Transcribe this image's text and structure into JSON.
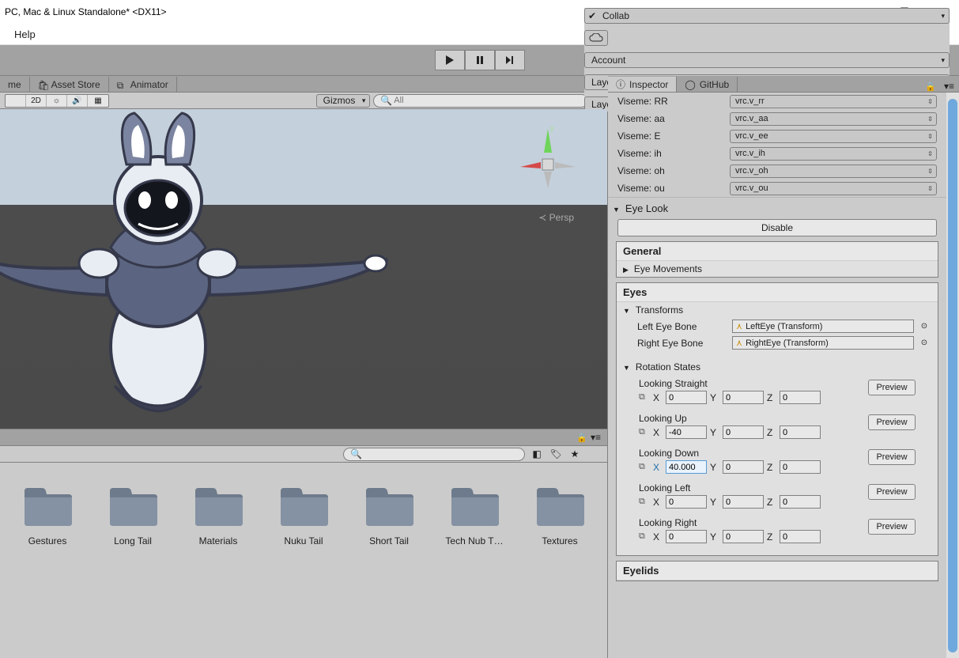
{
  "titlebar": {
    "title": "PC, Mac & Linux Standalone* <DX11>"
  },
  "menubar": {
    "items": [
      "Help"
    ]
  },
  "toolbar": {
    "collab": "Collab",
    "account": "Account",
    "layers": "Layers",
    "layout": "Layout"
  },
  "left_tabs": {
    "scene": "me",
    "asset_store": "Asset Store",
    "animator": "Animator"
  },
  "scene_tools": {
    "mode_2d": "2D",
    "gizmos": "Gizmos",
    "search_placeholder": "All"
  },
  "viewport": {
    "persp_label": "Persp"
  },
  "assets": [
    "Gestures",
    "Long Tail",
    "Materials",
    "Nuku Tail",
    "Short Tail",
    "Tech Nub T…",
    "Textures"
  ],
  "inspector_tabs": {
    "inspector": "Inspector",
    "github": "GitHub"
  },
  "visemes": [
    {
      "label": "Viseme: RR",
      "value": "vrc.v_rr"
    },
    {
      "label": "Viseme: aa",
      "value": "vrc.v_aa"
    },
    {
      "label": "Viseme: E",
      "value": "vrc.v_ee"
    },
    {
      "label": "Viseme: ih",
      "value": "vrc.v_ih"
    },
    {
      "label": "Viseme: oh",
      "value": "vrc.v_oh"
    },
    {
      "label": "Viseme: ou",
      "value": "vrc.v_ou"
    }
  ],
  "eye_look": {
    "header": "Eye Look",
    "disable": "Disable",
    "general": "General",
    "eye_movements": "Eye Movements"
  },
  "eyes": {
    "header": "Eyes",
    "transforms": "Transforms",
    "left_label": "Left Eye Bone",
    "left_value": "LeftEye (Transform)",
    "right_label": "Right Eye Bone",
    "right_value": "RightEye (Transform)"
  },
  "rotation": {
    "header": "Rotation States",
    "preview": "Preview",
    "items": [
      {
        "label": "Looking Straight",
        "x": "0",
        "y": "0",
        "z": "0",
        "highlight": false
      },
      {
        "label": "Looking Up",
        "x": "-40",
        "y": "0",
        "z": "0",
        "highlight": false
      },
      {
        "label": "Looking Down",
        "x": "40.000",
        "y": "0",
        "z": "0",
        "highlight": true
      },
      {
        "label": "Looking Left",
        "x": "0",
        "y": "0",
        "z": "0",
        "highlight": false
      },
      {
        "label": "Looking Right",
        "x": "0",
        "y": "0",
        "z": "0",
        "highlight": false
      }
    ]
  },
  "eyelids": {
    "header": "Eyelids"
  }
}
